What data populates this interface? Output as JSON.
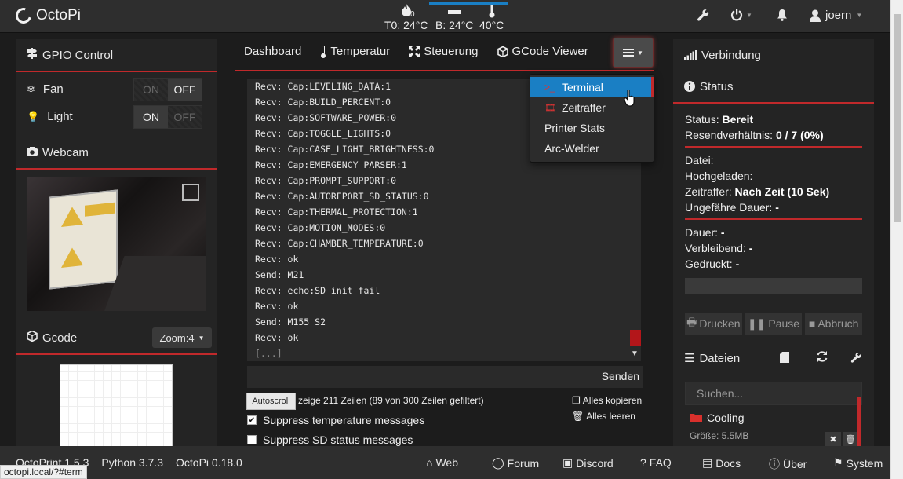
{
  "navbar": {
    "brand": "OctoPi",
    "tool_temp": "T0: 24°C",
    "bed_temp": "B: 24°C",
    "chamber_temp": "40°C",
    "tool_sub": "0",
    "user": "joern"
  },
  "left": {
    "gpio_title": "GPIO Control",
    "gpio": [
      {
        "name": "Fan",
        "on": "ON",
        "off": "OFF",
        "state": "OFF"
      },
      {
        "name": "Light",
        "on": "ON",
        "off": "OFF",
        "state": "ON"
      }
    ],
    "webcam_title": "Webcam",
    "gcode_title": "Gcode",
    "zoom_label": "Zoom:4"
  },
  "tabs": [
    {
      "label": "Dashboard"
    },
    {
      "label": "Temperatur"
    },
    {
      "label": "Steuerung"
    },
    {
      "label": "GCode Viewer"
    }
  ],
  "terminal": {
    "lines": [
      "Recv: Cap:LEVELING_DATA:1",
      "Recv: Cap:BUILD_PERCENT:0",
      "Recv: Cap:SOFTWARE_POWER:0",
      "Recv: Cap:TOGGLE_LIGHTS:0",
      "Recv: Cap:CASE_LIGHT_BRIGHTNESS:0",
      "Recv: Cap:EMERGENCY_PARSER:1",
      "Recv: Cap:PROMPT_SUPPORT:0",
      "Recv: Cap:AUTOREPORT_SD_STATUS:0",
      "Recv: Cap:THERMAL_PROTECTION:1",
      "Recv: Cap:MOTION_MODES:0",
      "Recv: Cap:CHAMBER_TEMPERATURE:0",
      "Recv: ok",
      "Send: M21",
      "Recv: echo:SD init fail",
      "Recv: ok",
      "Send: M155 S2",
      "Recv: ok"
    ],
    "ellipsis": "[...]",
    "send_label": "Senden",
    "autoscroll_label": "Autoscroll",
    "lines_info": "zeige 211 Zeilen (89 von 300 Zeilen gefiltert)",
    "copy_all": "Alles kopieren",
    "clear_all": "Alles leeren",
    "suppress_temp": "Suppress temperature messages",
    "suppress_sd": "Suppress SD status messages"
  },
  "dropdown": {
    "items": [
      {
        "label": "Terminal",
        "active": true
      },
      {
        "label": "Zeitraffer",
        "active": false
      },
      {
        "label": "Printer Stats",
        "active": false
      },
      {
        "label": "Arc-Welder",
        "active": false
      }
    ]
  },
  "right": {
    "connection_title": "Verbindung",
    "status_title": "Status",
    "status_label": "Status:",
    "status_value": "Bereit",
    "resend_label": "Resendverhältnis:",
    "resend_value": "0 / 7 (0%)",
    "file_label": "Datei:",
    "uploaded_label": "Hochgeladen:",
    "timelapse_label": "Zeitraffer:",
    "timelapse_value": "Nach Zeit (10 Sek)",
    "approx_label": "Ungefähre Dauer:",
    "approx_value": "-",
    "duration_label": "Dauer:",
    "duration_value": "-",
    "remaining_label": "Verbleibend:",
    "remaining_value": "-",
    "printed_label": "Gedruckt:",
    "printed_value": "-",
    "print_btn": "Drucken",
    "pause_btn": "Pause",
    "cancel_btn": "Abbruch",
    "files_title": "Dateien",
    "search_placeholder": "Suchen...",
    "folder_name": "Cooling",
    "folder_size": "Größe: 5.5MB"
  },
  "footer": {
    "octoprint": "OctoPrint 1.5.3",
    "python": "Python 3.7.3",
    "octopi": "OctoPi 0.18.0",
    "links": [
      "Web",
      "Forum",
      "Discord",
      "FAQ",
      "Docs",
      "Über",
      "System"
    ]
  },
  "statusbar_url": "octopi.local/?#term"
}
